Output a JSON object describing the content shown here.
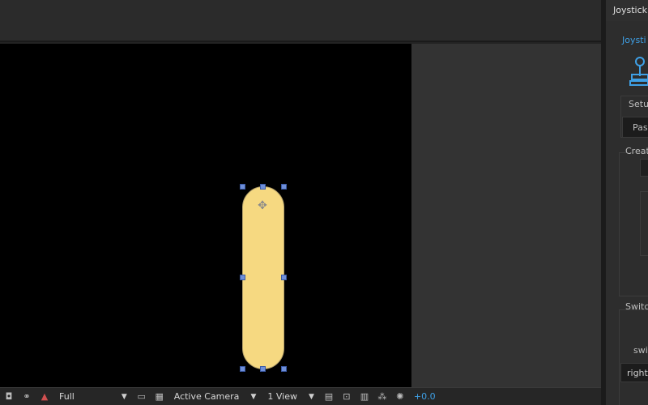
{
  "panel": {
    "tab_title": "Joystick",
    "section_title": "Joysti",
    "setup_label": "Setu",
    "paste_label": "Pas",
    "create_label": "Creat",
    "switch_label": "Switc",
    "switch_sub_label": "swi",
    "right_label": "right/"
  },
  "toolbar": {
    "resolution": "Full",
    "camera": "Active Camera",
    "views": "1 View",
    "exposure": "+0.0"
  },
  "colors": {
    "shape_fill": "#f6d981",
    "accent": "#3ea0e6",
    "handle": "#6f8fd9"
  }
}
